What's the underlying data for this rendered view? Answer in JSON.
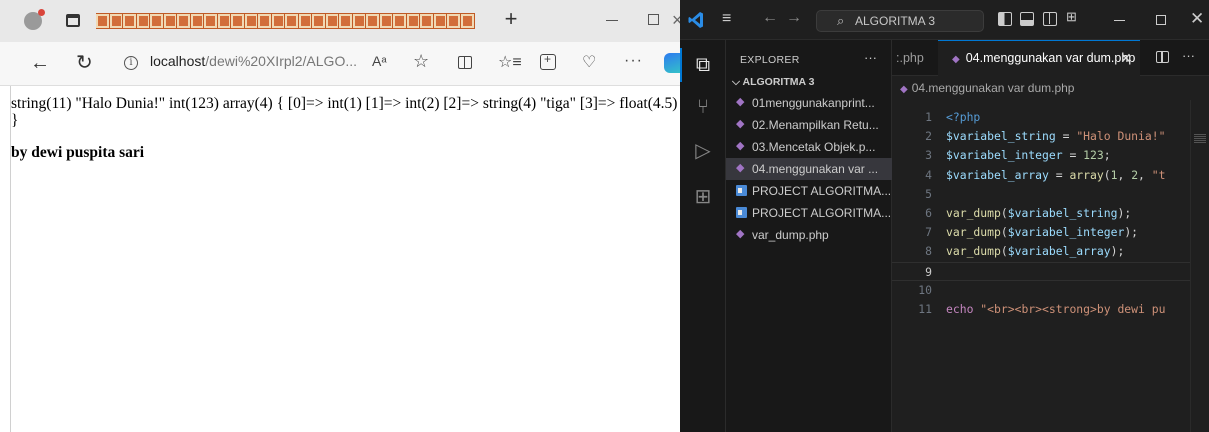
{
  "browser": {
    "tab_title_glyph_count": 28,
    "new_tab_symbol": "+",
    "url_host": "localhost",
    "url_path": "/dewi%20XIrpl2/ALGO...",
    "info_icon": "i",
    "read_aloud": "Aᵃ",
    "page": {
      "var_dump_output": "string(11) \"Halo Dunia!\" int(123) array(4) { [0]=> int(1) [1]=> int(2) [2]=> string(4) \"tiga\" [3]=> float(4.5)",
      "closing_brace": "}",
      "author_line": "by dewi puspita sari"
    }
  },
  "vscode": {
    "search_text": "ALGORITMA 3",
    "sidebar": {
      "title": "EXPLORER",
      "more": "···",
      "folder": "ALGORITMA 3",
      "items": [
        {
          "label": "01menggunakanprint...",
          "type": "php",
          "active": false
        },
        {
          "label": "02.Menampilkan Retu...",
          "type": "php",
          "active": false
        },
        {
          "label": "03.Mencetak Objek.p...",
          "type": "php",
          "active": false
        },
        {
          "label": "04.menggunakan var ...",
          "type": "php",
          "active": true
        },
        {
          "label": "PROJECT ALGORITMA...",
          "type": "doc",
          "active": false
        },
        {
          "label": "PROJECT ALGORITMA...",
          "type": "doc",
          "active": false
        },
        {
          "label": "var_dump.php",
          "type": "php",
          "active": false
        }
      ]
    },
    "editor": {
      "prev_tab": ":.php",
      "active_tab": "04.menggunakan var dum.php",
      "breadcrumb": "04.menggunakan var dum.php",
      "current_line": 9,
      "lines": [
        {
          "n": "1",
          "parts": [
            [
              "k-tag",
              "<?php"
            ]
          ]
        },
        {
          "n": "2",
          "parts": [
            [
              "k-var",
              "$variabel_string"
            ],
            [
              "k-pun",
              " = "
            ],
            [
              "k-str",
              "\"Halo Dunia!\""
            ]
          ]
        },
        {
          "n": "3",
          "parts": [
            [
              "k-var",
              "$variabel_integer"
            ],
            [
              "k-pun",
              " = "
            ],
            [
              "k-num",
              "123"
            ],
            [
              "k-pun",
              ";"
            ]
          ]
        },
        {
          "n": "4",
          "parts": [
            [
              "k-var",
              "$variabel_array"
            ],
            [
              "k-pun",
              " = "
            ],
            [
              "k-fn",
              "array"
            ],
            [
              "k-pun",
              "("
            ],
            [
              "k-num",
              "1"
            ],
            [
              "k-pun",
              ", "
            ],
            [
              "k-num",
              "2"
            ],
            [
              "k-pun",
              ", "
            ],
            [
              "k-str",
              "\"t"
            ]
          ]
        },
        {
          "n": "5",
          "parts": []
        },
        {
          "n": "6",
          "parts": [
            [
              "k-fn",
              "var_dump"
            ],
            [
              "k-pun",
              "("
            ],
            [
              "k-var",
              "$variabel_string"
            ],
            [
              "k-pun",
              ");"
            ]
          ]
        },
        {
          "n": "7",
          "parts": [
            [
              "k-fn",
              "var_dump"
            ],
            [
              "k-pun",
              "("
            ],
            [
              "k-var",
              "$variabel_integer"
            ],
            [
              "k-pun",
              ");"
            ]
          ]
        },
        {
          "n": "8",
          "parts": [
            [
              "k-fn",
              "var_dump"
            ],
            [
              "k-pun",
              "("
            ],
            [
              "k-var",
              "$variabel_array"
            ],
            [
              "k-pun",
              ");"
            ]
          ]
        },
        {
          "n": "9",
          "parts": []
        },
        {
          "n": "10",
          "parts": []
        },
        {
          "n": "11",
          "parts": [
            [
              "k-kw",
              "echo"
            ],
            [
              "k-pun",
              " "
            ],
            [
              "k-str",
              "\"<br><br><strong>by dewi pu"
            ]
          ]
        }
      ]
    }
  },
  "colors": {
    "vscode_bg": "#1f1f1f",
    "vscode_sidebar": "#181818",
    "accent": "#0078d4",
    "php_icon": "#a074c4",
    "tab_glyph": "#d26e3a"
  }
}
